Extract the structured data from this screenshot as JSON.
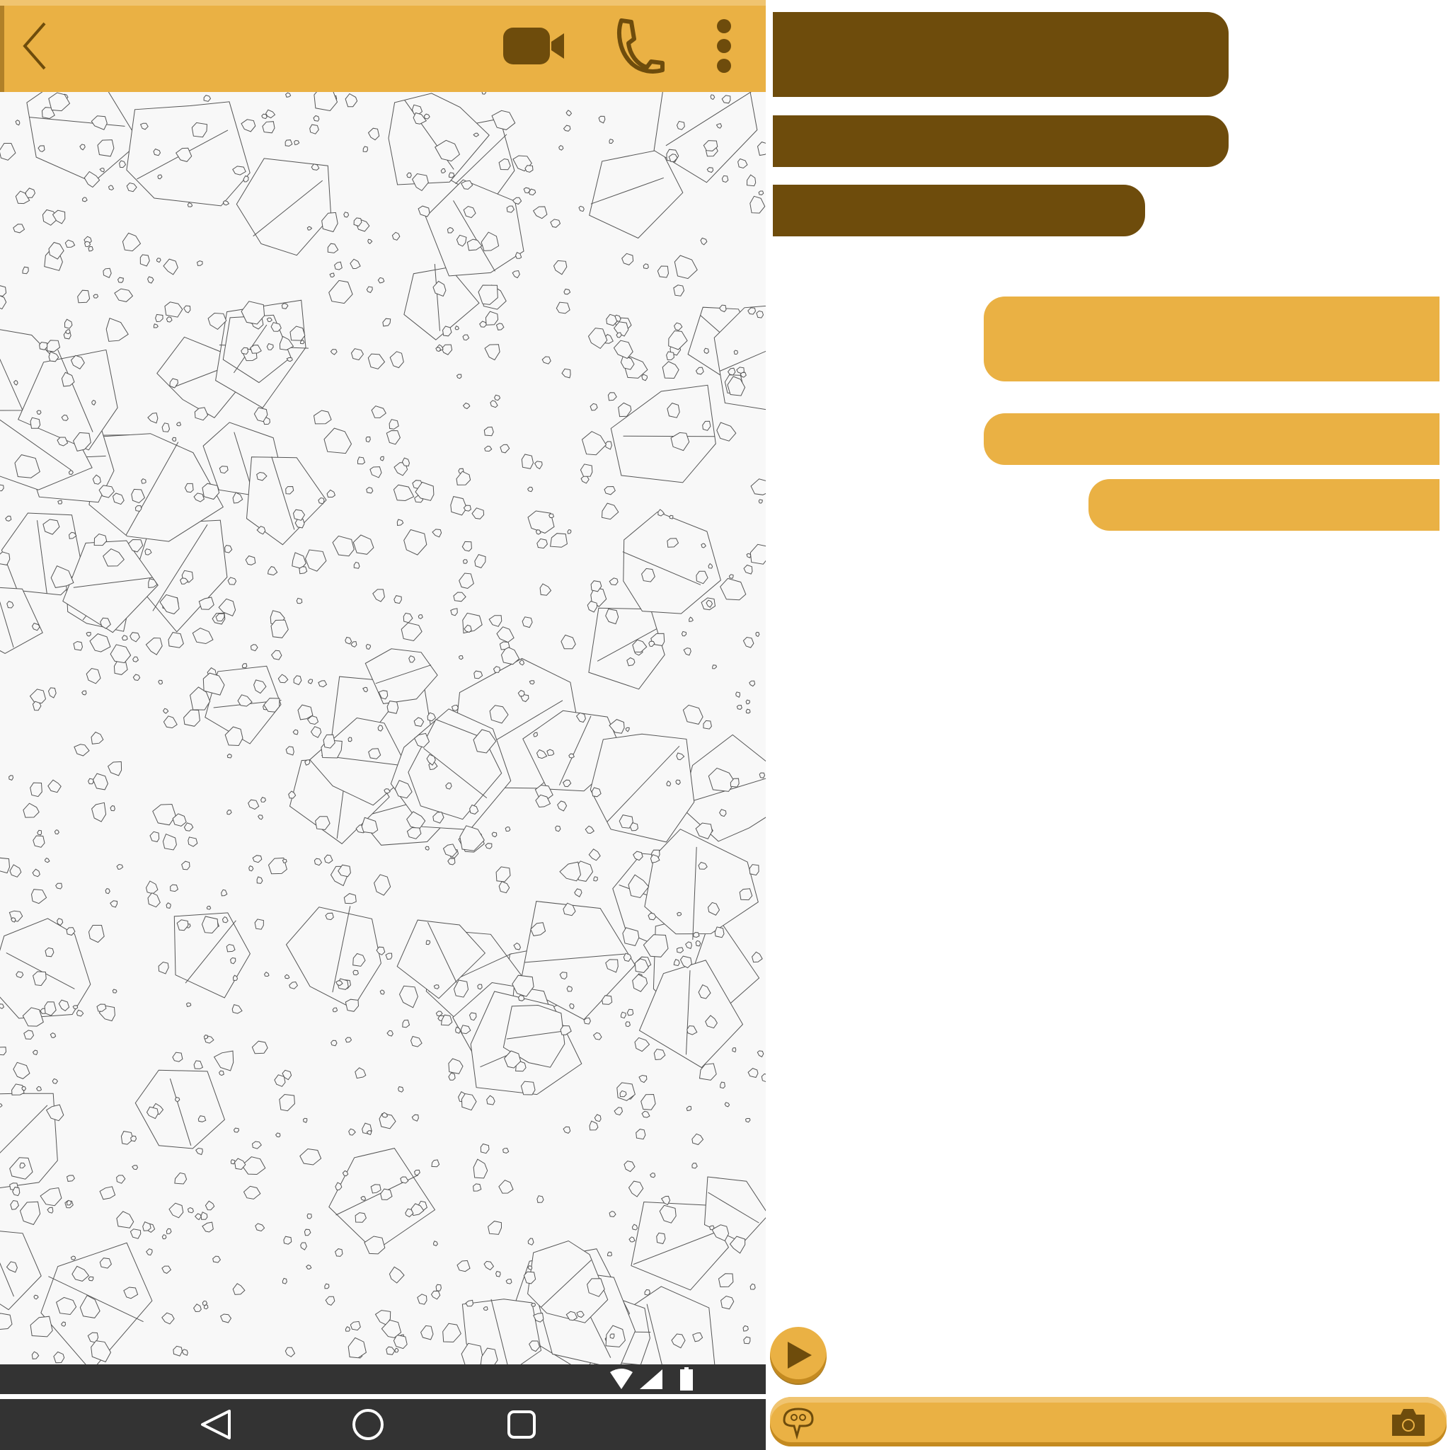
{
  "header": {
    "back_icon": "chevron-left-icon",
    "video_icon": "video-camera-icon",
    "call_icon": "phone-icon",
    "menu_icon": "more-vertical-icon"
  },
  "chat": {
    "wallpaper": "stone-pattern",
    "messages": []
  },
  "status_bar": {
    "icons": [
      "wifi-icon",
      "signal-icon",
      "battery-icon"
    ]
  },
  "nav_bar": {
    "icons": [
      "back-triangle-icon",
      "home-circle-icon",
      "recents-square-icon"
    ]
  },
  "kit": {
    "received_bubbles": [
      {
        "style": "received",
        "text": ""
      },
      {
        "style": "received",
        "text": ""
      },
      {
        "style": "received",
        "text": ""
      }
    ],
    "sent_bubbles": [
      {
        "style": "sent",
        "text": ""
      },
      {
        "style": "sent",
        "text": ""
      },
      {
        "style": "sent",
        "text": ""
      }
    ],
    "play_icon": "play-icon",
    "input": {
      "placeholder": "",
      "left_icon": "emoji-sticker-icon",
      "right_icon": "camera-icon"
    }
  },
  "colors": {
    "primary": "#eab144",
    "primary_dark": "#6e4c0c",
    "bar_dark": "#333333",
    "wallpaper": "#f8f8f8"
  }
}
